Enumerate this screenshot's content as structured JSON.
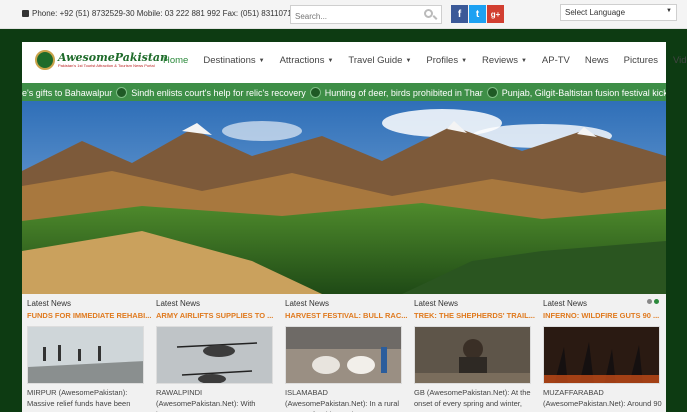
{
  "topbar": {
    "contact": "Phone: +92 (51) 8732529-30 Mobile: 03 222 881 992 Fax: (051) 8311071",
    "search_placeholder": "Search...",
    "social": {
      "facebook": "f",
      "twitter": "t",
      "googleplus": "g+"
    },
    "language_select": "Select Language"
  },
  "logo": {
    "name": "AwesomePakistan",
    "tagline": "Pakistan's 1st Tourist Attraction & Tourism News Portal"
  },
  "nav": {
    "items": [
      {
        "label": "Home"
      },
      {
        "label": "Destinations"
      },
      {
        "label": "Attractions"
      },
      {
        "label": "Travel Guide"
      },
      {
        "label": "Profiles"
      },
      {
        "label": "Reviews"
      },
      {
        "label": "AP-TV"
      },
      {
        "label": "News"
      },
      {
        "label": "Pictures"
      },
      {
        "label": "Videos"
      }
    ]
  },
  "ticker": {
    "items": [
      "re's gifts to Bahawalpur",
      "Sindh enlists court's help for relic's recovery",
      "Hunting of deer, birds prohibited in Thar",
      "Punjab, Gilgit-Baltistan fusion festival kicks off in Lahore"
    ]
  },
  "cards": [
    {
      "kicker": "Latest News",
      "title": "FUNDS FOR IMMEDIATE REHABI...",
      "text": "MIRPUR (AwesomePakistan): Massive relief funds have been"
    },
    {
      "kicker": "Latest News",
      "title": "ARMY AIRLIFTS SUPPLIES TO ...",
      "text": "RAWALPINDI (AwesomePakistan.Net): With heavy"
    },
    {
      "kicker": "Latest News",
      "title": "HARVEST FESTIVAL: BULL RAC...",
      "text": "ISLAMABAD (AwesomePakistan.Net): In a rural corner of Pakistan, the"
    },
    {
      "kicker": "Latest News",
      "title": "TREK: THE SHEPHERDS' TRAIL...",
      "text": "GB (AwesomePakistan.Net): At the onset of every spring and winter,"
    },
    {
      "kicker": "Latest News",
      "title": "INFERNO: WILDFIRE GUTS 90 ...",
      "text": "MUZAFFARABAD (AwesomePakistan.Net): Around 90"
    }
  ]
}
